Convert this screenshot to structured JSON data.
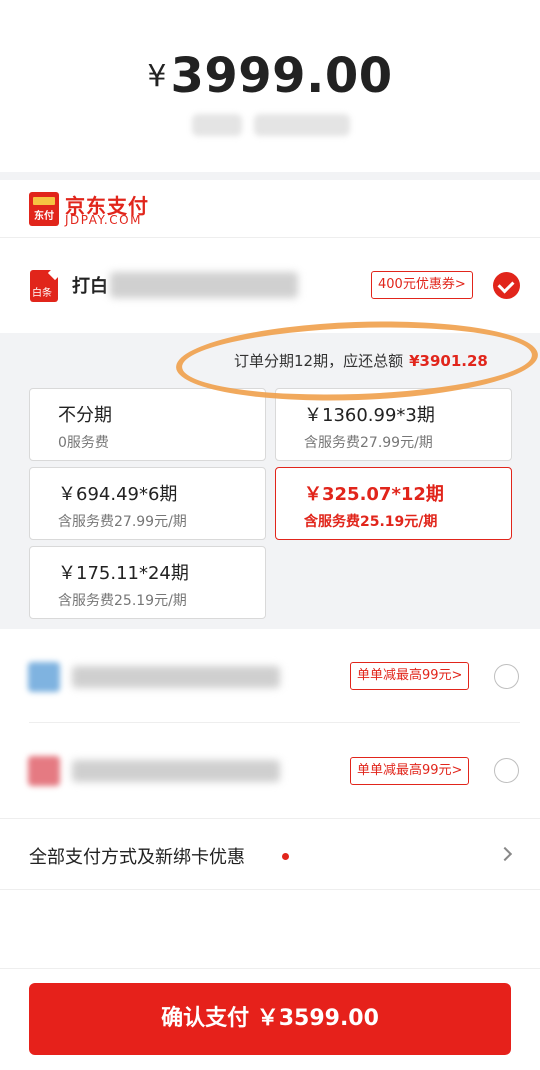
{
  "order": {
    "currency": "¥",
    "amount": "3999.00"
  },
  "jdpay": {
    "brand_name": "京东支付",
    "brand_sub": "JDPAY.COM",
    "logo_text": "东付"
  },
  "baitiao": {
    "icon_text": "白条",
    "name_visible": "打白",
    "coupon_tag": "400元优惠券>"
  },
  "installment": {
    "summary_label": "订单分期12期，应还总额",
    "summary_total": "¥3901.28",
    "options": [
      {
        "title": "不分期",
        "fee": "0服务费",
        "selected": false
      },
      {
        "title": "￥1360.99*3期",
        "fee": "含服务费27.99元/期",
        "selected": false
      },
      {
        "title": "￥694.49*6期",
        "fee": "含服务费27.99元/期",
        "selected": false
      },
      {
        "title": "￥325.07*12期",
        "fee": "含服务费25.19元/期",
        "selected": true
      },
      {
        "title": "￥175.11*24期",
        "fee": "含服务费25.19元/期",
        "selected": false
      }
    ]
  },
  "other_methods": [
    {
      "promo_tag": "单单减最高99元>",
      "icon_color": "#7fb3e0"
    },
    {
      "promo_tag": "单单减最高99元>",
      "icon_color": "#e57a82"
    }
  ],
  "all_methods": {
    "label": "全部支付方式及新绑卡优惠"
  },
  "confirm": {
    "label": "确认支付 ￥3599.00"
  },
  "colors": {
    "accent": "#e1251b",
    "annotation": "#f0a04b"
  }
}
